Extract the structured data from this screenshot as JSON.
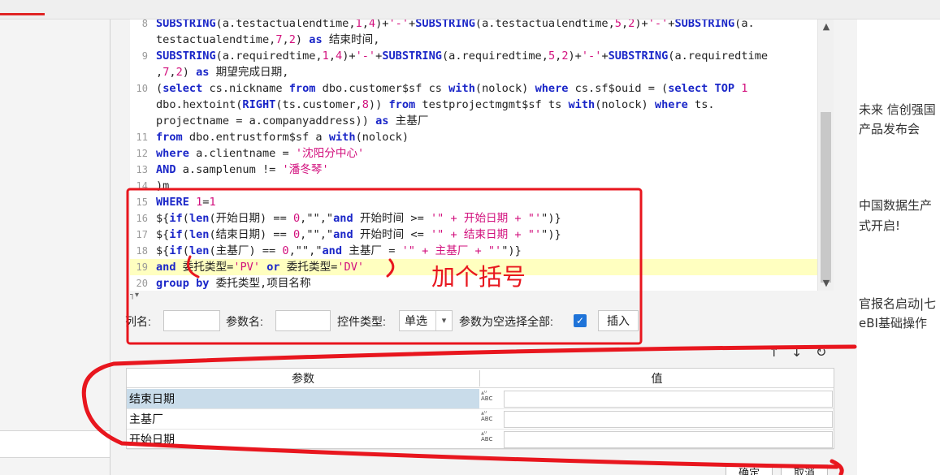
{
  "background": {
    "news_lines": [
      "未来 信创强国",
      "产品发布会",
      "中国数据生产",
      "式开启!",
      "官报名启动|七",
      "eBI基础操作"
    ]
  },
  "editor": {
    "lines": [
      {
        "n": "8",
        "text": "SUBSTRING(a.testactualendtime,1,4)+'-'+SUBSTRING(a.testactualendtime,5,2)+'-'+SUBSTRING(a."
      },
      {
        "n": "",
        "text": "testactualendtime,7,2) as 结束时间,"
      },
      {
        "n": "9",
        "text": "SUBSTRING(a.requiredtime,1,4)+'-'+SUBSTRING(a.requiredtime,5,2)+'-'+SUBSTRING(a.requiredtime"
      },
      {
        "n": "",
        "text": ",7,2) as 期望完成日期,"
      },
      {
        "n": "10",
        "text": "(select cs.nickname from dbo.customer$sf cs with(nolock) where cs.sf$ouid = (select TOP 1"
      },
      {
        "n": "",
        "text": "dbo.hextoint(RIGHT(ts.customer,8)) from testprojectmgmt$sf ts with(nolock) where ts."
      },
      {
        "n": "",
        "text": "projectname = a.companyaddress)) as 主基厂"
      },
      {
        "n": "11",
        "text": "from dbo.entrustform$sf a with(nolock)"
      },
      {
        "n": "12",
        "text": "where a.clientname = '沈阳分中心'"
      },
      {
        "n": "13",
        "text": "AND a.samplenum != '潘冬琴'"
      },
      {
        "n": "14",
        "text": ")m"
      },
      {
        "n": "15",
        "text": "WHERE 1=1"
      },
      {
        "n": "16",
        "text": "${if(len(开始日期) == 0,\"\",\"and 开始时间 >= '\" + 开始日期 + \"'\")}"
      },
      {
        "n": "17",
        "text": "${if(len(结束日期) == 0,\"\",\"and 开始时间 <= '\" + 结束日期 + \"'\")}"
      },
      {
        "n": "18",
        "text": "${if(len(主基厂) == 0,\"\",\"and 主基厂 = '\" + 主基厂 + \"'\")}"
      },
      {
        "n": "19",
        "text": "and 委托类型='PV' or 委托类型='DV'",
        "highlight": true
      },
      {
        "n": "20",
        "text": "group by 委托类型,项目名称"
      }
    ]
  },
  "form": {
    "column_label": "列名:",
    "param_label": "参数名:",
    "control_type_label": "控件类型:",
    "control_type_value": "单选",
    "select_all_label": "参数为空选择全部:",
    "select_all_checked": true,
    "insert_button": "插入"
  },
  "grid": {
    "header_param": "参数",
    "header_value": "值",
    "icon_text": "ABC",
    "rows": [
      {
        "name": "结束日期",
        "value": "",
        "selected": true
      },
      {
        "name": "主基厂",
        "value": "",
        "selected": false
      },
      {
        "name": "开始日期",
        "value": "",
        "selected": false
      }
    ]
  },
  "footer": {
    "ok_button": "确定",
    "cancel_button": "取消"
  },
  "annotation": {
    "text": "加个括号",
    "color": "#e8161e"
  }
}
